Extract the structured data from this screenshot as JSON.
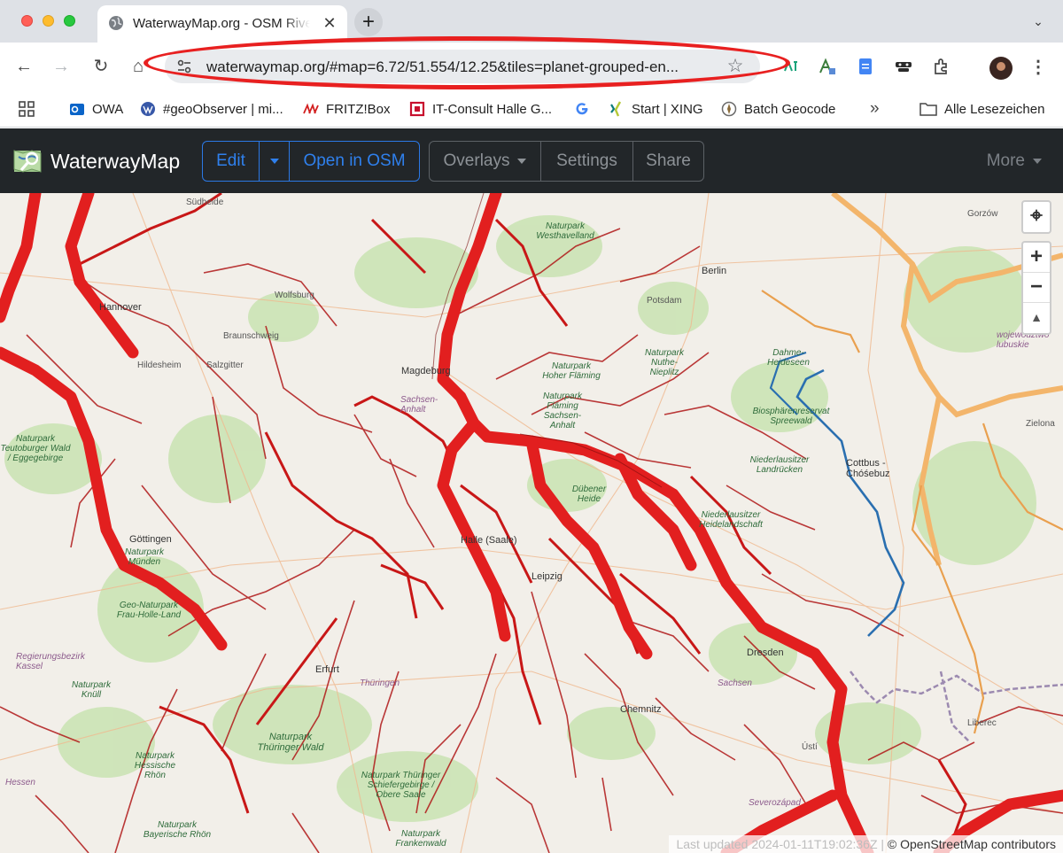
{
  "browser": {
    "tab": {
      "title": "WaterwayMap.org - OSM River Basins",
      "close": "✕"
    },
    "new_tab": "+",
    "tab_search": "⌄",
    "toolbar": {
      "back": "←",
      "forward": "→",
      "reload": "↻",
      "home": "⌂",
      "url": "waterwaymap.org/#map=6.72/51.554/12.25&tiles=planet-grouped-en...",
      "bookmark": "☆",
      "menu": "⋮"
    },
    "bookmarks": {
      "apps": "",
      "items": [
        "OWA",
        "#geoObserver | mi...",
        "FRITZ!Box",
        "IT-Consult Halle G...",
        "",
        "Start | XING",
        "Batch Geocode"
      ],
      "overflow": "»",
      "all_bookmarks": "Alle Lesezeichen"
    },
    "annotation_color": "#e82020"
  },
  "app": {
    "brand": "WaterwayMap",
    "edit_group": {
      "edit": "Edit",
      "open_osm": "Open in OSM"
    },
    "view_group": {
      "overlays": "Overlays",
      "settings": "Settings",
      "share": "Share"
    },
    "more": "More",
    "accent": "#2f80ed"
  },
  "map": {
    "controls": {
      "locate": "⌖",
      "zoom_in": "+",
      "zoom_out": "−",
      "compass": "▲"
    },
    "attribution_faint": "Last updated 2024-01-11T19:02:36Z |",
    "attribution": "© OpenStreetMap contributors",
    "labels": {
      "gorzow": "Gorzów",
      "sudheide": "Südheide",
      "westhavelland": "Naturpark Westhavelland",
      "berlin": "Berlin",
      "hannover": "Hannover",
      "wolfsburg": "Wolfsburg",
      "potsdam": "Potsdam",
      "braunschweig": "Braunschweig",
      "hildesheim": "Hildesheim",
      "salzgitter": "Salzgitter",
      "magdeburg": "Magdeburg",
      "hoher_flaming": "Naturpark Hoher Fläming",
      "nuthe": "Naturpark Nuthe-Nieplitz",
      "dahme": "Dahme-Heideseen",
      "wojewodztwo": "województwo lubuskie",
      "sachsen_anhalt": "Sachsen-Anhalt",
      "flaming_sachsen": "Naturpark Fläming Sachsen-Anhalt",
      "spreewald": "Biosphärenreservat Spreewald",
      "zielona": "Zielona",
      "teutoburger": "Naturpark Teutoburger Wald / Eggegebirge",
      "niederlausitzer": "Niederlausitzer Landrücken",
      "cottbus": "Cottbus - Chóśebuz",
      "dubener": "Dübener Heide",
      "nl_heide": "Niederlausitzer Heidelandschaft",
      "goettingen": "Göttingen",
      "muenden": "Naturpark Münden",
      "halle": "Halle (Saale)",
      "leipzig": "Leipzig",
      "frau_holle": "Geo-Naturpark Frau-Holle-Land",
      "kassel": "Regierungsbezirk Kassel",
      "erfurt": "Erfurt",
      "thueringen": "Thüringen",
      "sachsen": "Sachsen",
      "dresden": "Dresden",
      "knuell": "Naturpark Knüll",
      "chemnitz": "Chemnitz",
      "liberec": "Liberec",
      "thueringer_wald": "Naturpark Thüringer Wald",
      "hessische_rhoen": "Naturpark Hessische Rhön",
      "hessen": "Hessen",
      "schiefergebirge": "Naturpark Thüringer Schiefergebirge / Obere Saale",
      "usti": "Ústí",
      "severozapad": "Severozápad",
      "bayerische_rhoen": "Naturpark Bayerische Rhön",
      "frankenwald": "Naturpark Frankenwald"
    }
  }
}
